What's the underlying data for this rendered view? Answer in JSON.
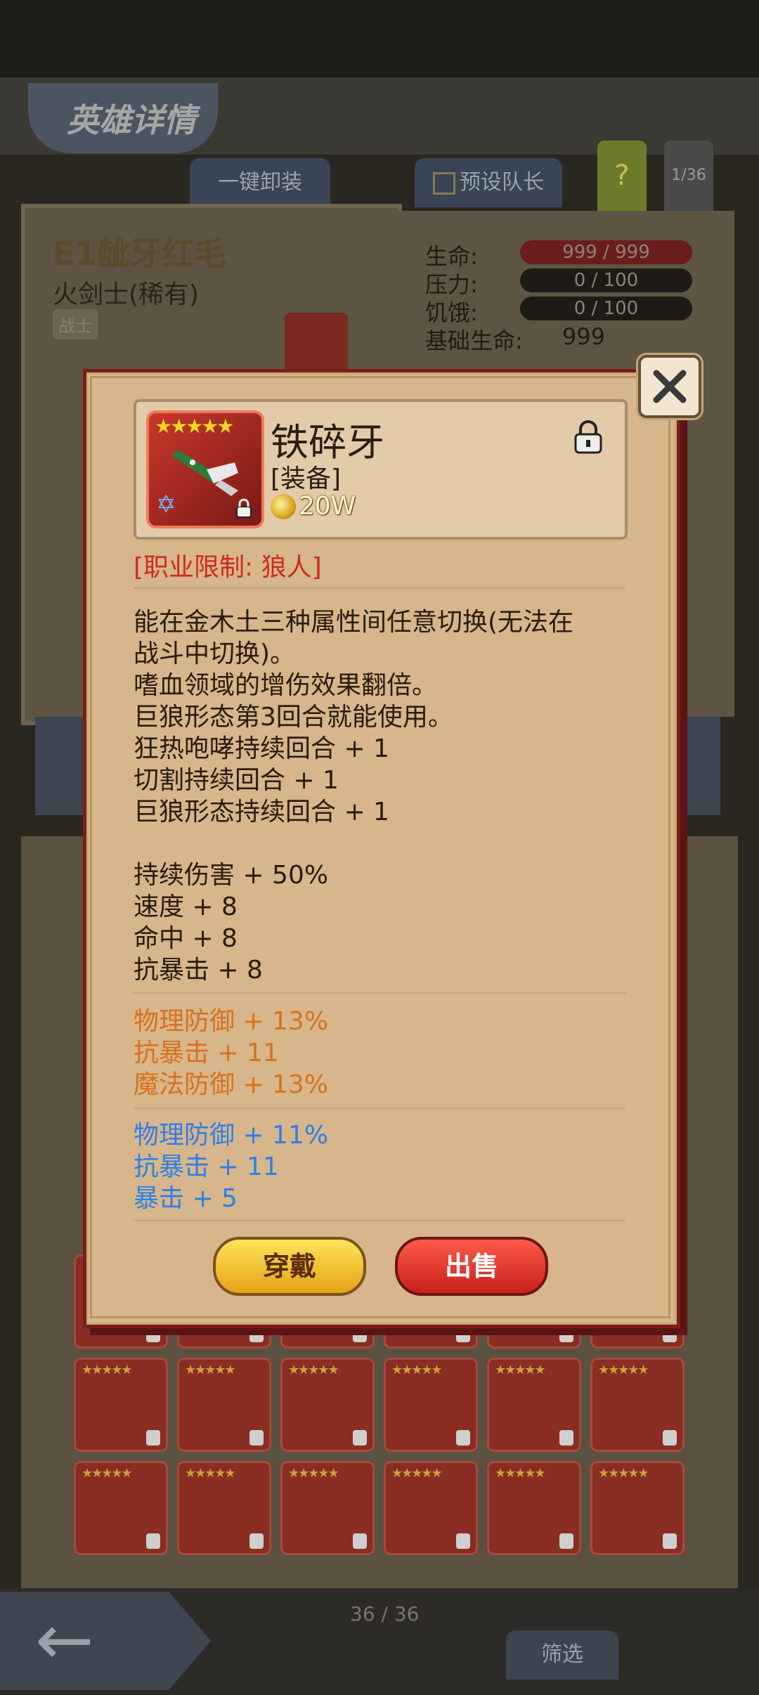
{
  "screen": {
    "title": "英雄详情",
    "unequip_all_label": "一键卸装",
    "preset_captain_label": "预设队长",
    "help_label": "?",
    "hero_index": "1/36"
  },
  "hero": {
    "name": "E1龇牙红毛",
    "class": "火剑士(稀有)",
    "role": "战士"
  },
  "stats": {
    "life_label": "生命:",
    "life_value": "999 / 999",
    "stress_label": "压力:",
    "stress_value": "0 / 100",
    "hunger_label": "饥饿:",
    "hunger_value": "0 / 100",
    "base_life_label": "基础生命:",
    "base_life_value": "999"
  },
  "item": {
    "name": "铁碎牙",
    "type": "[装备]",
    "price": "20W",
    "stars": "★★★★★",
    "restriction": "[职业限制: 狼人]",
    "description": [
      "能在金木土三种属性间任意切换(无法在",
      "战斗中切换)。",
      "嗜血领域的增伤效果翻倍。",
      "巨狼形态第3回合就能使用。",
      "狂热咆哮持续回合 + 1",
      "切割持续回合 + 1",
      "巨狼形态持续回合 + 1"
    ],
    "base_stats": [
      "持续伤害 + 50%",
      "速度 + 8",
      "命中 + 8",
      "抗暴击 + 8"
    ],
    "orange_stats": [
      "物理防御 + 13%",
      "抗暴击 + 11",
      "魔法防御 + 13%"
    ],
    "blue_stats": [
      "物理防御 + 11%",
      "抗暴击 + 11",
      "暴击 + 5"
    ]
  },
  "buttons": {
    "wear": "穿戴",
    "sell": "出售"
  },
  "footer": {
    "page": "36 / 36",
    "filter": "筛选"
  },
  "colors": {
    "restriction": "#d02a20",
    "orange_stats": "#d9711e",
    "blue_stats": "#2f7fe8"
  }
}
